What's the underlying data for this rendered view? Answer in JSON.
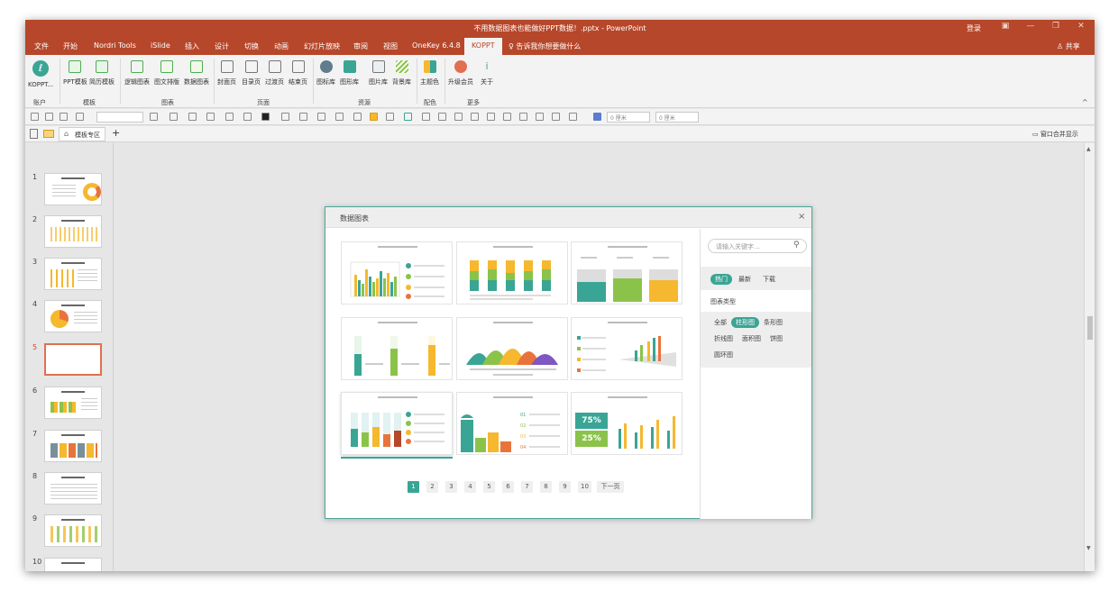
{
  "window": {
    "title": "不用数据图表也能做好PPT数据！.pptx - PowerPoint",
    "login": "登录",
    "controls": [
      "▣",
      "—",
      "❐",
      "✕"
    ]
  },
  "tabs": [
    "文件",
    "开始",
    "Nordri Tools",
    "iSlide",
    "插入",
    "设计",
    "切换",
    "动画",
    "幻灯片放映",
    "审阅",
    "视图",
    "OneKey 6.4.8",
    "KOPPT"
  ],
  "active_tab": "KOPPT",
  "tell_me": "告诉我你想要做什么",
  "share": "共享",
  "ribbon": {
    "buttons": [
      "KOPPT...",
      "PPT模板",
      "简历模板",
      "逻辑图表",
      "图文排版",
      "数据图表",
      "封面页",
      "目录页",
      "过渡页",
      "结束页",
      "图标库",
      "图形库",
      "图片库",
      "背景库",
      "主题色",
      "升级会员",
      "关于"
    ],
    "groups": [
      "账户",
      "模板",
      "图表",
      "页面",
      "资源",
      "配色",
      "更多"
    ],
    "collapse": "^"
  },
  "toolbar2": {
    "field1": "0 厘米",
    "field2": "0 厘米"
  },
  "tabstrip": {
    "template_zone": "模板专区",
    "add": "+",
    "merge_label": "窗口合并显示"
  },
  "slides": [
    "1",
    "2",
    "3",
    "4",
    "5",
    "6",
    "7",
    "8",
    "9",
    "10"
  ],
  "selected_slide": "5",
  "dialog": {
    "title": "数据图表",
    "close": "×",
    "search_placeholder": "请输入关键字...",
    "sort_tabs": [
      "热门",
      "最新",
      "下载"
    ],
    "category_title": "图表类型",
    "categories": [
      "全部",
      "柱形图",
      "条形图",
      "折线图",
      "面积图",
      "饼图",
      "圆环图"
    ],
    "active_category": "柱形图",
    "card_numbers": [
      "75%",
      "25%"
    ],
    "pages": [
      "1",
      "2",
      "3",
      "4",
      "5",
      "6",
      "7",
      "8",
      "9",
      "10"
    ],
    "next_page": "下一页",
    "current_page": "1"
  },
  "colors": {
    "accent_red": "#b7472a",
    "teal": "#3aa595",
    "yellow": "#f5b82e",
    "orange": "#e8743b",
    "green": "#8bc34a",
    "purple": "#7e57c2",
    "sel_border": "#e0704f"
  }
}
